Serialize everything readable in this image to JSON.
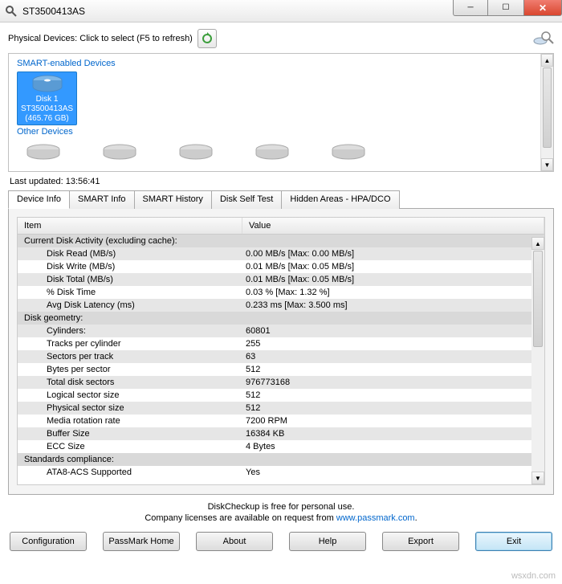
{
  "window": {
    "title": "ST3500413AS"
  },
  "toprow": {
    "label": "Physical Devices: Click to select (F5 to refresh)"
  },
  "sections": {
    "smart": "SMART-enabled Devices",
    "other": "Other Devices"
  },
  "selected_disk": {
    "name": "Disk 1",
    "model": "ST3500413AS",
    "size": "(465.76 GB)"
  },
  "last_updated": "Last updated: 13:56:41",
  "tabs": [
    "Device Info",
    "SMART Info",
    "SMART History",
    "Disk Self Test",
    "Hidden Areas - HPA/DCO"
  ],
  "table": {
    "headers": {
      "item": "Item",
      "value": "Value"
    },
    "rows": [
      {
        "group": true,
        "item": "Current Disk Activity (excluding cache):",
        "value": ""
      },
      {
        "indent": true,
        "item": "Disk Read (MB/s)",
        "value": "0.00 MB/s  [Max: 0.00 MB/s]"
      },
      {
        "indent": true,
        "item": "Disk Write (MB/s)",
        "value": "0.01 MB/s  [Max: 0.05 MB/s]"
      },
      {
        "indent": true,
        "item": "Disk Total (MB/s)",
        "value": "0.01 MB/s  [Max: 0.05 MB/s]"
      },
      {
        "indent": true,
        "item": "% Disk Time",
        "value": "0.03 %     [Max: 1.32 %]"
      },
      {
        "indent": true,
        "item": "Avg Disk Latency (ms)",
        "value": "0.233 ms   [Max: 3.500 ms]"
      },
      {
        "group": true,
        "item": "Disk geometry:",
        "value": ""
      },
      {
        "indent": true,
        "item": "Cylinders:",
        "value": "60801"
      },
      {
        "indent": true,
        "item": "Tracks per cylinder",
        "value": "255"
      },
      {
        "indent": true,
        "item": "Sectors per track",
        "value": "63"
      },
      {
        "indent": true,
        "item": "Bytes per sector",
        "value": "512"
      },
      {
        "indent": true,
        "item": "Total disk sectors",
        "value": "976773168"
      },
      {
        "indent": true,
        "item": "Logical sector size",
        "value": "512"
      },
      {
        "indent": true,
        "item": "Physical sector size",
        "value": "512"
      },
      {
        "indent": true,
        "item": "Media rotation rate",
        "value": "7200 RPM"
      },
      {
        "indent": true,
        "item": "Buffer Size",
        "value": "16384 KB"
      },
      {
        "indent": true,
        "item": "ECC Size",
        "value": "4 Bytes"
      },
      {
        "group": true,
        "item": "Standards compliance:",
        "value": ""
      },
      {
        "indent": true,
        "item": "ATA8-ACS Supported",
        "value": "Yes"
      }
    ]
  },
  "footer": {
    "line1": "DiskCheckup is free for personal use.",
    "line2a": "Company licenses are available on request from ",
    "link": "www.passmark.com",
    "line2b": "."
  },
  "buttons": {
    "config": "Configuration",
    "home": "PassMark Home",
    "about": "About",
    "help": "Help",
    "export": "Export",
    "exit": "Exit"
  },
  "watermark": "wsxdn.com"
}
